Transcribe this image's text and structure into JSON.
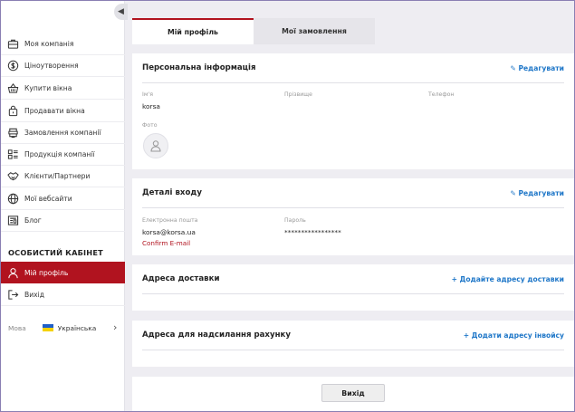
{
  "sidebar": {
    "items": [
      {
        "label": "Моя компанія",
        "icon": "company-icon"
      },
      {
        "label": "Ціноутворення",
        "icon": "dollar-icon"
      },
      {
        "label": "Купити вікна",
        "icon": "basket-icon"
      },
      {
        "label": "Продавати вікна",
        "icon": "lock-bag-icon"
      },
      {
        "label": "Замовлення компанії",
        "icon": "stack-icon"
      },
      {
        "label": "Продукція компанії",
        "icon": "list-icon"
      },
      {
        "label": "Клієнти/Партнери",
        "icon": "handshake-icon"
      },
      {
        "label": "Мої вебсайти",
        "icon": "globe-icon"
      },
      {
        "label": "Блог",
        "icon": "newspaper-icon"
      }
    ],
    "cabinet_heading": "ОСОБИСТИЙ КАБІНЕТ",
    "profile_item": "Мій профіль",
    "logout_item": "Вихід",
    "language": {
      "label": "Мова",
      "value": "Українська"
    }
  },
  "tabs": {
    "profile": "Мій профіль",
    "orders": "Мої замовлення"
  },
  "personal": {
    "title": "Персональна інформація",
    "edit": "Редагувати",
    "first_name_label": "Ім'я",
    "first_name": "korsa",
    "last_name_label": "Прізвище",
    "phone_label": "Телефон",
    "photo_label": "Фото"
  },
  "login": {
    "title": "Деталі входу",
    "edit": "Редагувати",
    "email_label": "Електронна пошта",
    "email": "korsa@korsa.ua",
    "confirm": "Confirm E-mail",
    "password_label": "Пароль",
    "password": "*****************"
  },
  "delivery": {
    "title": "Адреса доставки",
    "add": "+ Додайте адресу доставки"
  },
  "invoice": {
    "title": "Адреса для надсилання рахунку",
    "add": "+ Додати адресу інвойсу"
  },
  "footer": {
    "logout_button": "Вихід"
  },
  "colors": {
    "accent": "#b1131f",
    "link": "#1f77c8",
    "background": "#eeedf2"
  }
}
